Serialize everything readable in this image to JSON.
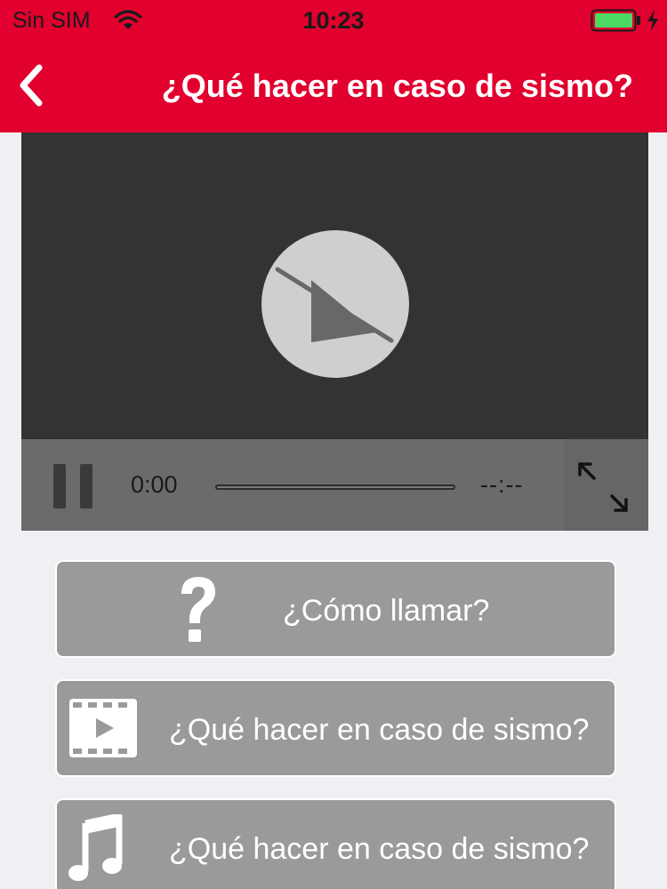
{
  "status_bar": {
    "carrier": "Sin SIM",
    "time": "10:23",
    "wifi_icon": "wifi-icon",
    "battery_icon": "battery-icon",
    "charging_icon": "charging-bolt-icon",
    "battery_color": "#4cd964"
  },
  "nav": {
    "back_icon": "chevron-left-icon",
    "title": "¿Qué hacer en caso de sismo?"
  },
  "player": {
    "current_time": "0:00",
    "remaining_time": "--:--",
    "progress": 0,
    "play_icon": "play-disabled-icon",
    "pause_icon": "pause-icon",
    "fullscreen_icon": "fullscreen-expand-icon"
  },
  "menu": [
    {
      "label": "¿Cómo llamar?",
      "icon": "question-mark-icon"
    },
    {
      "label": "¿Qué hacer en caso de sismo?",
      "icon": "video-film-icon"
    },
    {
      "label": "¿Qué hacer en caso de sismo?",
      "icon": "music-note-icon"
    }
  ],
  "colors": {
    "brand_red": "#e1002e",
    "card_gray": "#9a9a9a",
    "player_dark": "#333333",
    "controls_gray": "#6b6b6b"
  }
}
